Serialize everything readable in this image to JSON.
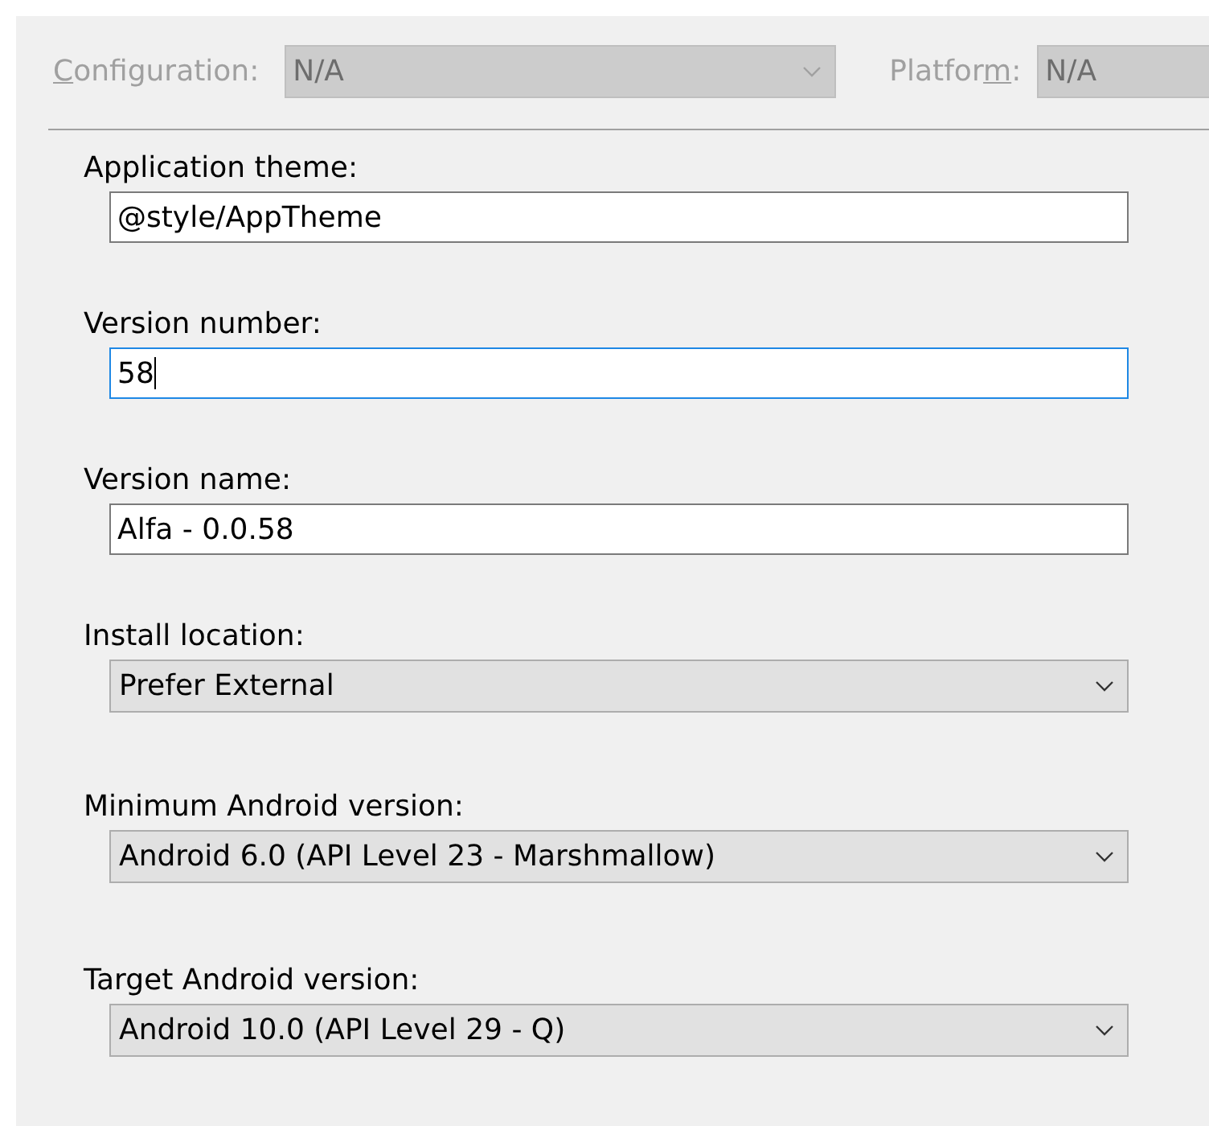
{
  "toolbar": {
    "configuration": {
      "label": [
        {
          "text": "C",
          "underlined": true
        },
        {
          "text": "onfiguration:",
          "underlined": false
        }
      ],
      "value": "N/A",
      "disabled": true
    },
    "platform": {
      "label": [
        {
          "text": "Platfor",
          "underlined": false
        },
        {
          "text": "m",
          "underlined": true
        },
        {
          "text": ":",
          "underlined": false
        }
      ],
      "value": "N/A",
      "disabled": true
    }
  },
  "fields": [
    {
      "kind": "text",
      "label": "Application theme:",
      "value": "@style/AppTheme",
      "focused": false
    },
    {
      "kind": "text",
      "label": "Version number:",
      "value": "58",
      "focused": true
    },
    {
      "kind": "text",
      "label": "Version name:",
      "value": "Alfa - 0.0.58",
      "focused": false
    },
    {
      "kind": "dropdown",
      "label": "Install location:",
      "value": "Prefer External",
      "focused": false
    },
    {
      "kind": "dropdown",
      "label": "Minimum Android version:",
      "value": "Android 6.0 (API Level 23 - Marshmallow)",
      "focused": false
    },
    {
      "kind": "dropdown",
      "label": "Target Android version:",
      "value": "Android 10.0 (API Level 29 - Q)",
      "focused": false
    }
  ]
}
